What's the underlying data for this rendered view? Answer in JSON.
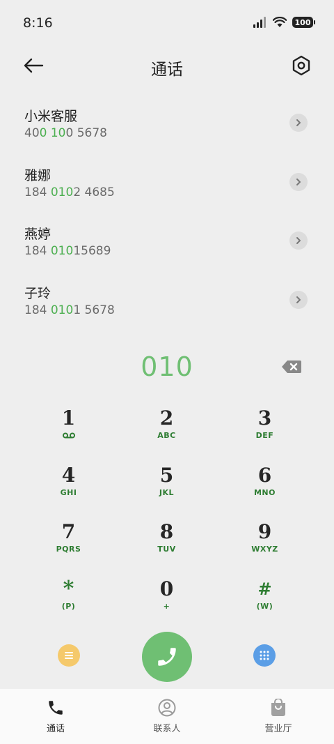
{
  "status_bar": {
    "time": "8:16",
    "battery": "100"
  },
  "header": {
    "title": "通话"
  },
  "contacts": [
    {
      "name": "小米客服",
      "number_parts": [
        "40",
        "0 10",
        "0 5678"
      ]
    },
    {
      "name": "雅娜",
      "number_parts": [
        "184 ",
        "010",
        "2 4685"
      ]
    },
    {
      "name": "燕婷",
      "number_parts": [
        "184 ",
        "010",
        "15689"
      ]
    },
    {
      "name": "子玲",
      "number_parts": [
        "184 ",
        "010",
        "1 5678"
      ]
    }
  ],
  "dial_input": {
    "digits": "010"
  },
  "keypad": [
    {
      "digit": "1",
      "sub": ""
    },
    {
      "digit": "2",
      "sub": "ABC"
    },
    {
      "digit": "3",
      "sub": "DEF"
    },
    {
      "digit": "4",
      "sub": "GHI"
    },
    {
      "digit": "5",
      "sub": "JKL"
    },
    {
      "digit": "6",
      "sub": "MNO"
    },
    {
      "digit": "7",
      "sub": "PQRS"
    },
    {
      "digit": "8",
      "sub": "TUV"
    },
    {
      "digit": "9",
      "sub": "WXYZ"
    },
    {
      "digit": "*",
      "sub": "(P)"
    },
    {
      "digit": "0",
      "sub": "+"
    },
    {
      "digit": "#",
      "sub": "(W)"
    }
  ],
  "bottom_nav": {
    "calls": "通话",
    "contacts": "联系人",
    "store": "营业厅"
  },
  "colors": {
    "accent_green": "#6fbf73",
    "key_sub_green": "#2e7d32",
    "menu_yellow": "#f5c96b",
    "dialpad_blue": "#5b9ee6",
    "background": "#eeeeee"
  },
  "icons": {
    "back": "arrow-left-icon",
    "settings": "hexagon-settings-icon",
    "chevron": "chevron-right-icon",
    "backspace": "backspace-icon",
    "voicemail": "voicemail-icon",
    "menu": "menu-lines-icon",
    "call": "phone-icon",
    "dialpad": "dialpad-dots-icon",
    "nav_calls": "phone-icon",
    "nav_contacts": "person-circle-icon",
    "nav_store": "shopping-bag-icon"
  }
}
